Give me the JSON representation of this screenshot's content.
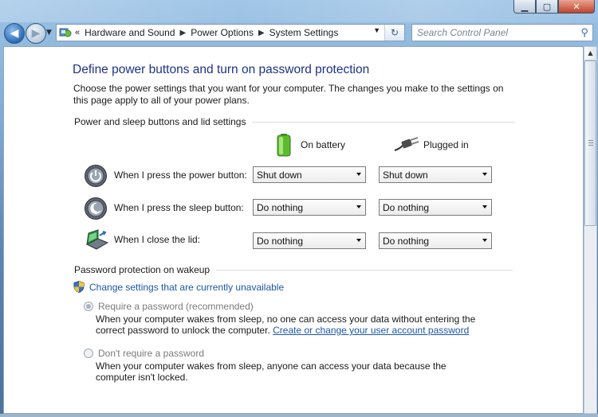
{
  "window": {
    "minimize_label": "▁",
    "maximize_label": "▢",
    "close_label": "✕"
  },
  "nav": {
    "back_icon": "back-arrow-icon",
    "forward_icon": "forward-arrow-icon"
  },
  "address": {
    "overflow": "«",
    "crumbs": [
      "Hardware and Sound",
      "Power Options",
      "System Settings"
    ]
  },
  "search": {
    "placeholder": "Search Control Panel"
  },
  "page": {
    "title": "Define power buttons and turn on password protection",
    "description": "Choose the power settings that you want for your computer. The changes you make to the settings on this page apply to all of your power plans."
  },
  "power_section": {
    "title": "Power and sleep buttons and lid settings",
    "col_battery": "On battery",
    "col_plugged": "Plugged in",
    "rows": [
      {
        "label": "When I press the power button:",
        "battery": "Shut down",
        "plugged": "Shut down",
        "icon": "power-button-icon"
      },
      {
        "label": "When I press the sleep button:",
        "battery": "Do nothing",
        "plugged": "Do nothing",
        "icon": "sleep-button-icon"
      },
      {
        "label": "When I close the lid:",
        "battery": "Do nothing",
        "plugged": "Do nothing",
        "icon": "laptop-lid-icon"
      }
    ]
  },
  "password_section": {
    "title": "Password protection on wakeup",
    "change_link": "Change settings that are currently unavailable",
    "require_label": "Require a password (recommended)",
    "require_text": "When your computer wakes from sleep, no one can access your data without entering the correct password to unlock the computer.",
    "require_link": "Create or change your user account password",
    "dont_label": "Don't require a password",
    "dont_text": "When your computer wakes from sleep, anyone can access your data because the computer isn't locked."
  }
}
